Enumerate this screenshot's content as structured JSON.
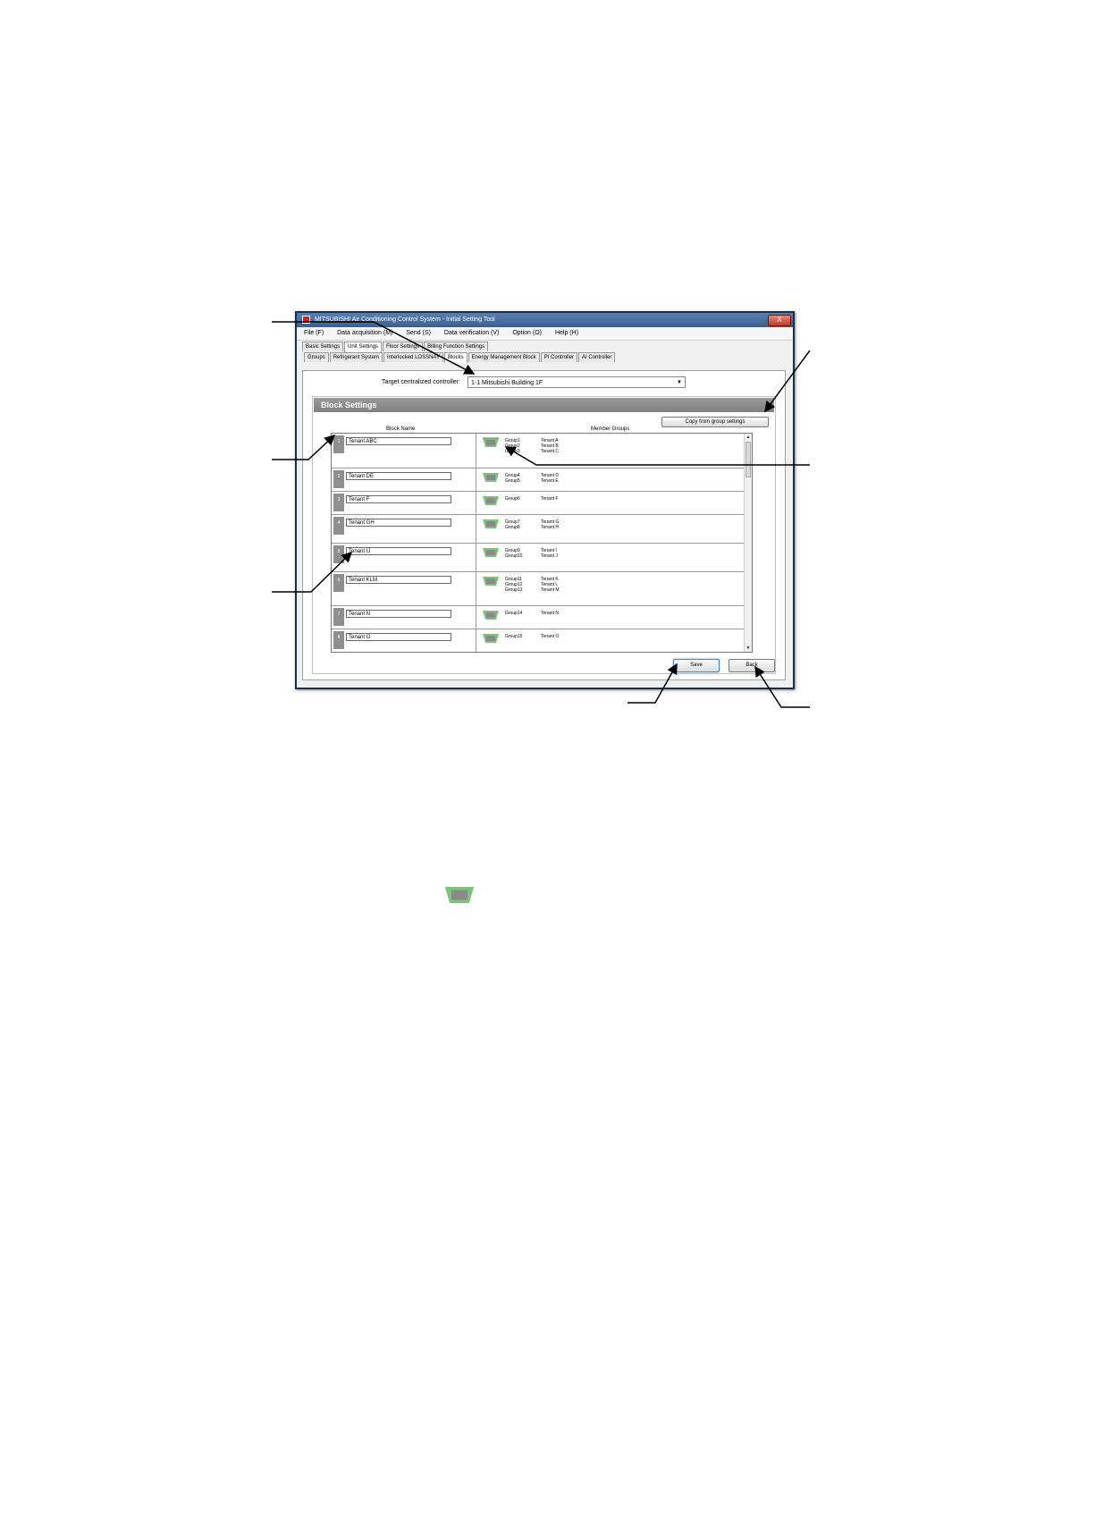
{
  "window": {
    "title": "MITSUBISHI Air Conditioning Control System - Initial Setting Tool",
    "close_label": "X"
  },
  "menu": [
    "File (F)",
    "Data acquisition (M)",
    "Send (S)",
    "Data verification (V)",
    "Option (O)",
    "Help (H)"
  ],
  "tabs_main": [
    {
      "label": "Basic Settings",
      "active": false
    },
    {
      "label": "Unit Settings",
      "active": true
    },
    {
      "label": "Floor Settings",
      "active": false
    },
    {
      "label": "Billing Function Settings",
      "active": false
    }
  ],
  "tabs_sub": [
    {
      "label": "Groups",
      "active": false
    },
    {
      "label": "Refrigerant System",
      "active": false
    },
    {
      "label": "Interlocked LOSSNAY",
      "active": false
    },
    {
      "label": "Blocks",
      "active": true
    },
    {
      "label": "Energy Management Block",
      "active": false
    },
    {
      "label": "PI Controller",
      "active": false
    },
    {
      "label": "AI Controller",
      "active": false
    }
  ],
  "target": {
    "label": "Target centralized controller:",
    "value": "1-1  Mitsubishi Building 1F"
  },
  "section": {
    "title": "Block Settings",
    "copy_button": "Copy from group settings",
    "col_block_name": "Block Name",
    "col_member_groups": "Member Groups"
  },
  "blocks": [
    {
      "num": "1",
      "name": "Tenant ABC",
      "groups": [
        "Group1",
        "Group2",
        "Group3"
      ],
      "tenants": [
        "Tenant A",
        "Tenant B",
        "Tenant C"
      ]
    },
    {
      "num": "2",
      "name": "Tenant DE",
      "groups": [
        "Group4",
        "Group5"
      ],
      "tenants": [
        "Tenant D",
        "Tenant E"
      ]
    },
    {
      "num": "3",
      "name": "Tenant F",
      "groups": [
        "Group6"
      ],
      "tenants": [
        "Tenant F"
      ]
    },
    {
      "num": "4",
      "name": "Tenant GH",
      "groups": [
        "Group7",
        "Group8"
      ],
      "tenants": [
        "Tenant G",
        "Tenant H"
      ]
    },
    {
      "num": "5",
      "name": "Tenant IJ",
      "groups": [
        "Group9",
        "Group10"
      ],
      "tenants": [
        "Tenant I",
        "Tenant J"
      ]
    },
    {
      "num": "6",
      "name": "Tenant KLM",
      "groups": [
        "Group11",
        "Group12",
        "Group13"
      ],
      "tenants": [
        "Tenant K",
        "Tenant L",
        "Tenant M"
      ]
    },
    {
      "num": "7",
      "name": "Tenant N",
      "groups": [
        "Group14"
      ],
      "tenants": [
        "Tenant N"
      ]
    },
    {
      "num": "8",
      "name": "Tenant O",
      "groups": [
        "Group15"
      ],
      "tenants": [
        "Tenant O"
      ]
    }
  ],
  "buttons": {
    "save": "Save",
    "back": "Back"
  },
  "colors": {
    "unit_icon": "#7dc27a",
    "header_bg": "#8a8a8a",
    "title_bar": "#4a6fa0"
  }
}
